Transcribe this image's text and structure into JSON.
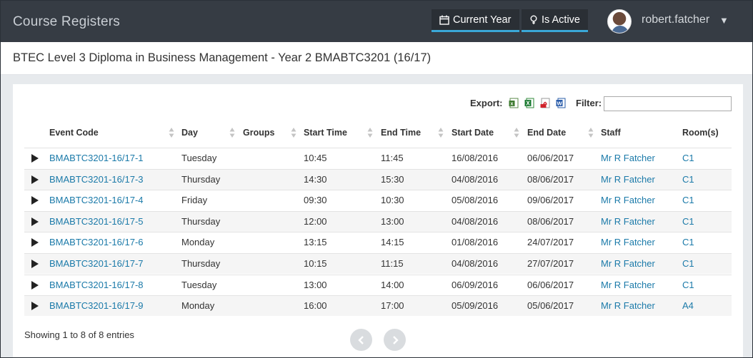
{
  "app": {
    "title": "Course Registers"
  },
  "header": {
    "filters": [
      {
        "label": "Current Year",
        "icon": "calendar-icon"
      },
      {
        "label": "Is Active",
        "icon": "lightbulb-icon"
      }
    ],
    "user": {
      "name": "robert.fatcher",
      "caret": "▼"
    }
  },
  "page": {
    "title": "BTEC Level 3 Diploma in Business Management - Year 2 BMABTC3201 (16/17)"
  },
  "toolbar": {
    "export_label": "Export:",
    "export_formats": [
      "csv-icon",
      "excel-icon",
      "pdf-icon",
      "word-icon"
    ],
    "filter_label": "Filter:",
    "filter_value": ""
  },
  "table": {
    "columns": [
      "Event Code",
      "Day",
      "Groups",
      "Start Time",
      "End Time",
      "Start Date",
      "End Date",
      "Staff",
      "Room(s)"
    ],
    "rows": [
      {
        "code": "BMABTC3201-16/17-1",
        "day": "Tuesday",
        "groups": "",
        "start": "10:45",
        "end": "11:45",
        "start_date": "16/08/2016",
        "end_date": "06/06/2017",
        "staff": "Mr R Fatcher",
        "room": "C1"
      },
      {
        "code": "BMABTC3201-16/17-3",
        "day": "Thursday",
        "groups": "",
        "start": "14:30",
        "end": "15:30",
        "start_date": "04/08/2016",
        "end_date": "08/06/2017",
        "staff": "Mr R Fatcher",
        "room": "C1"
      },
      {
        "code": "BMABTC3201-16/17-4",
        "day": "Friday",
        "groups": "",
        "start": "09:30",
        "end": "10:30",
        "start_date": "05/08/2016",
        "end_date": "09/06/2017",
        "staff": "Mr R Fatcher",
        "room": "C1"
      },
      {
        "code": "BMABTC3201-16/17-5",
        "day": "Thursday",
        "groups": "",
        "start": "12:00",
        "end": "13:00",
        "start_date": "04/08/2016",
        "end_date": "08/06/2017",
        "staff": "Mr R Fatcher",
        "room": "C1"
      },
      {
        "code": "BMABTC3201-16/17-6",
        "day": "Monday",
        "groups": "",
        "start": "13:15",
        "end": "14:15",
        "start_date": "01/08/2016",
        "end_date": "24/07/2017",
        "staff": "Mr R Fatcher",
        "room": "C1"
      },
      {
        "code": "BMABTC3201-16/17-7",
        "day": "Thursday",
        "groups": "",
        "start": "10:15",
        "end": "11:15",
        "start_date": "04/08/2016",
        "end_date": "27/07/2017",
        "staff": "Mr R Fatcher",
        "room": "C1"
      },
      {
        "code": "BMABTC3201-16/17-8",
        "day": "Tuesday",
        "groups": "",
        "start": "13:00",
        "end": "14:00",
        "start_date": "06/09/2016",
        "end_date": "06/06/2017",
        "staff": "Mr R Fatcher",
        "room": "C1"
      },
      {
        "code": "BMABTC3201-16/17-9",
        "day": "Monday",
        "groups": "",
        "start": "16:00",
        "end": "17:00",
        "start_date": "05/09/2016",
        "end_date": "05/06/2017",
        "staff": "Mr R Fatcher",
        "room": "A4"
      }
    ]
  },
  "footer": {
    "info": "Showing 1 to 8 of 8 entries",
    "pager": [
      "previous-icon",
      "next-icon"
    ]
  },
  "colors": {
    "topbar": "#363c44",
    "accent": "#3aa8d8",
    "link": "#1b7aa9",
    "panel_bg": "#e7eaed"
  }
}
